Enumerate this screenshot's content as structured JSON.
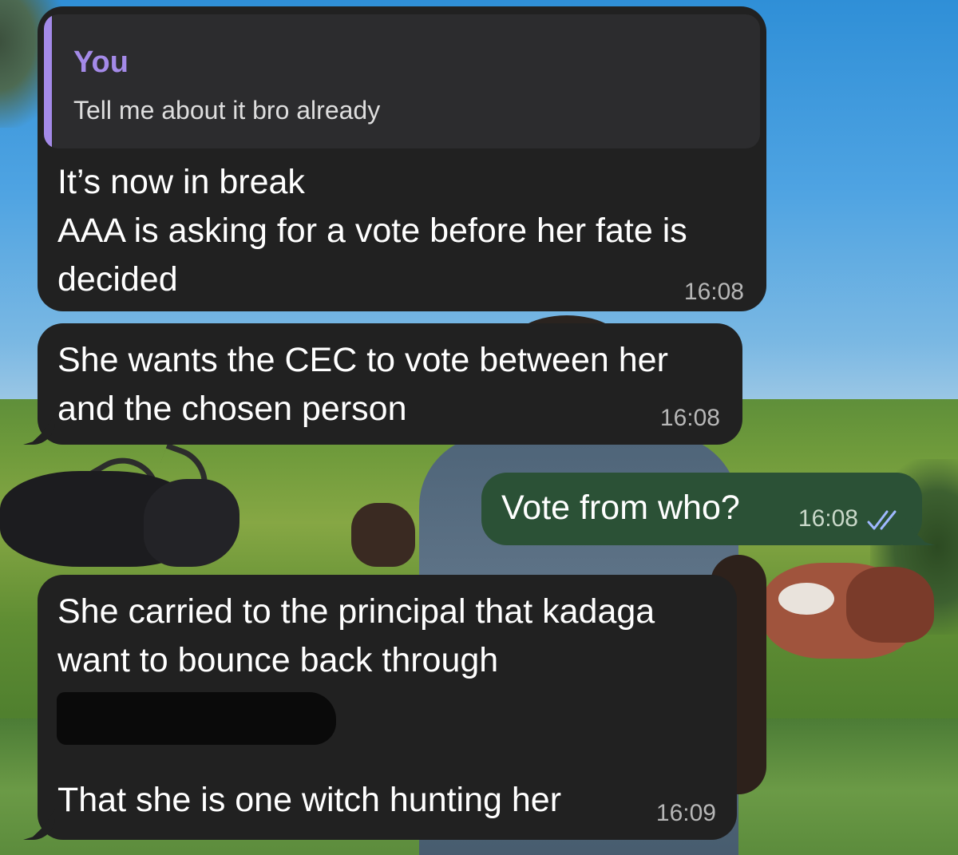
{
  "messages": [
    {
      "direction": "incoming",
      "reply_to": {
        "sender": "You",
        "text": "Tell me about it bro already"
      },
      "text": "It’s now in break\nAAA is asking for a vote before her fate is\ndecided",
      "time": "16:08"
    },
    {
      "direction": "incoming",
      "text": "She wants the CEC to vote between her\nand the chosen person",
      "time": "16:08"
    },
    {
      "direction": "outgoing",
      "text": "Vote from who?",
      "time": "16:08",
      "status_icon": "double-check-icon"
    },
    {
      "direction": "incoming",
      "text_part1": "She carried to the principal that kadaga\nwant to bounce back through",
      "redacted": true,
      "text_part2": "That she is one witch hunting her",
      "time": "16:09"
    }
  ],
  "colors": {
    "incoming_bubble": "#212121",
    "outgoing_bubble": "#2b5136",
    "reply_accent": "#a48ae8",
    "read_check": "#9fb8ff"
  },
  "background": "photo-wallpaper-cattle-field"
}
